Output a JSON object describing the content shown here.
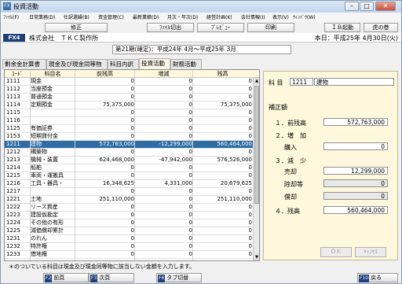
{
  "window": {
    "icon_text": "FX",
    "title": "投資活動",
    "minimize": "–",
    "maximize": "□",
    "close": "✕"
  },
  "menu": [
    "ﾌｧｲﾙ(F)",
    "日常業務(D)",
    "仕訳還繰(B)",
    "資金管理(C)",
    "最新業績(D)",
    "月次・年次(D)",
    "経営計画(K)",
    "会社情報(I)",
    "表示(V)",
    "ｳｨﾝﾄﾞｳ(W)"
  ],
  "toolbar": {
    "fix": "修正",
    "file_out": "ﾌｧｲﾙ切出",
    "preview": "ﾌﾟﾚﾋﾞｭｰ",
    "print": "印刷",
    "ib": "ＩＢ起動",
    "tora": "虎の巻"
  },
  "company": {
    "badge": "FX4",
    "name": "株式会社　ＴＫＣ製作所",
    "today": "本日：平成25年 4月30日(火)"
  },
  "period": "第21期(確定)：平成24年 4月～平成25年 3月",
  "tabs": [
    {
      "label": "剰余金計算書"
    },
    {
      "label": "現金及び現金同等物"
    },
    {
      "label": "科目内訳"
    },
    {
      "label": "投資活動"
    },
    {
      "label": "財務活動"
    }
  ],
  "grid": {
    "headers": [
      "ｺｰﾄﾞ",
      "科目名",
      "前残高",
      "増減",
      "残高"
    ],
    "rows": [
      {
        "code": "1111",
        "name": "現金",
        "prev": "0",
        "change": "0",
        "bal": "0"
      },
      {
        "code": "1112",
        "name": "当座預金",
        "prev": "0",
        "change": "0",
        "bal": "0"
      },
      {
        "code": "1113",
        "name": "普通預金",
        "prev": "0",
        "change": "0",
        "bal": "0"
      },
      {
        "code": "1114",
        "name": "定期預金",
        "prev": "75,375,000",
        "change": "0",
        "bal": "75,375,000"
      },
      {
        "code": "1115",
        "name": "",
        "prev": "0",
        "change": "0",
        "bal": "0"
      },
      {
        "code": "1116",
        "name": "",
        "prev": "0",
        "change": "0",
        "bal": "0"
      },
      {
        "code": "1125",
        "name": "有価証券",
        "prev": "0",
        "change": "0",
        "bal": "0"
      },
      {
        "code": "1153",
        "name": "短期貸付金",
        "prev": "0",
        "change": "0",
        "bal": "0"
      },
      {
        "code": "1211",
        "name": "建物",
        "prev": "572,763,000",
        "change": "-12,299,000",
        "bal": "560,464,000"
      },
      {
        "code": "1212",
        "name": "構築物",
        "prev": "0",
        "change": "0",
        "bal": "0"
      },
      {
        "code": "1213",
        "name": "機械・装置",
        "prev": "624,468,000",
        "change": "-47,942,000",
        "bal": "576,526,000"
      },
      {
        "code": "1214",
        "name": "船舶",
        "prev": "0",
        "change": "0",
        "bal": "0"
      },
      {
        "code": "1215",
        "name": "車両・運搬具",
        "prev": "0",
        "change": "0",
        "bal": "0"
      },
      {
        "code": "1216",
        "name": "工具・器具・",
        "prev": "16,348,625",
        "change": "4,331,000",
        "bal": "20,679,625"
      },
      {
        "code": "1217",
        "name": "",
        "prev": "0",
        "change": "0",
        "bal": "0"
      },
      {
        "code": "1221",
        "name": "土地",
        "prev": "251,110,000",
        "change": "0",
        "bal": "251,110,000"
      },
      {
        "code": "1222",
        "name": "リース資産",
        "prev": "0",
        "change": "0",
        "bal": "0"
      },
      {
        "code": "1223",
        "name": "建設仮勘定",
        "prev": "0",
        "change": "0",
        "bal": "0"
      },
      {
        "code": "1224",
        "name": "その他の有形",
        "prev": "0",
        "change": "0",
        "bal": "0"
      },
      {
        "code": "1225",
        "name": "減価償却累計",
        "prev": "0",
        "change": "0",
        "bal": "0"
      },
      {
        "code": "1231",
        "name": "のれん",
        "prev": "0",
        "change": "0",
        "bal": "0"
      },
      {
        "code": "1232",
        "name": "特許権",
        "prev": "0",
        "change": "0",
        "bal": "0"
      },
      {
        "code": "1233",
        "name": "借地権",
        "prev": "0",
        "change": "0",
        "bal": "0"
      }
    ],
    "selected_index": 8
  },
  "detail": {
    "kamoku_label": "科 目",
    "code": "1211",
    "name": "建物",
    "section": "補正額",
    "prev_label": "１．前残高",
    "prev_value": "572,763,000",
    "inc_label": "２．増　加",
    "buy_label": "購入",
    "buy_value": "0",
    "dec_label": "３．減　少",
    "sell_label": "売却",
    "sell_value": "12,299,000",
    "disp_label": "除却等",
    "disp_value": "0",
    "dep_label": "償却",
    "dep_value": "0",
    "bal_label": "４．残高",
    "bal_value": "560,464,000",
    "ok": "ＯＫ",
    "cancel": "ｷｬﾝｾﾙ"
  },
  "note": "＊のついている科目は現金及び現金同等物に該当しない金額を入力します。",
  "fkeys": [
    {
      "key": "F2",
      "label": "前頁"
    },
    {
      "key": "F3",
      "label": "次頁"
    },
    {
      "key": "F6",
      "label": "タブ切替"
    },
    {
      "key": "F10",
      "label": "戻る"
    }
  ]
}
